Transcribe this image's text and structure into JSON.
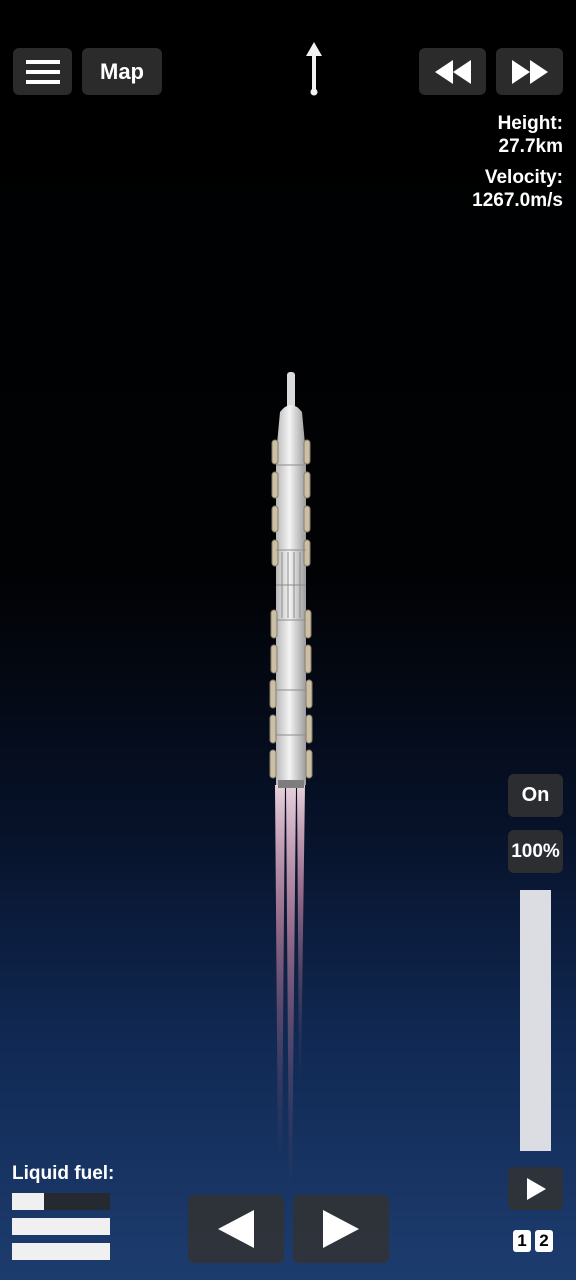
{
  "toolbar": {
    "menu_icon": "hamburger-menu-icon",
    "map_label": "Map",
    "rewind_icon": "rewind-icon",
    "fast_forward_icon": "fast-forward-icon"
  },
  "telemetry": {
    "height_label": "Height:",
    "height_value": "27.7km",
    "velocity_label": "Velocity:",
    "velocity_value": "1267.0m/s"
  },
  "engine": {
    "state_label": "On",
    "throttle_label": "100%",
    "throttle_level": 1.0,
    "play_icon": "play-icon"
  },
  "stages": [
    "1",
    "2"
  ],
  "fuel": {
    "label": "Liquid fuel:",
    "levels": [
      0.33,
      1.0,
      1.0
    ]
  },
  "controls": {
    "rotate_left_icon": "rotate-left-arrow-icon",
    "rotate_right_icon": "rotate-right-arrow-icon"
  },
  "colors": {
    "button_bg": "#323232",
    "throttle_fill": "#dcdde2",
    "exhaust": "#d8a0c0",
    "sky_bottom": "#1d3c6e"
  }
}
